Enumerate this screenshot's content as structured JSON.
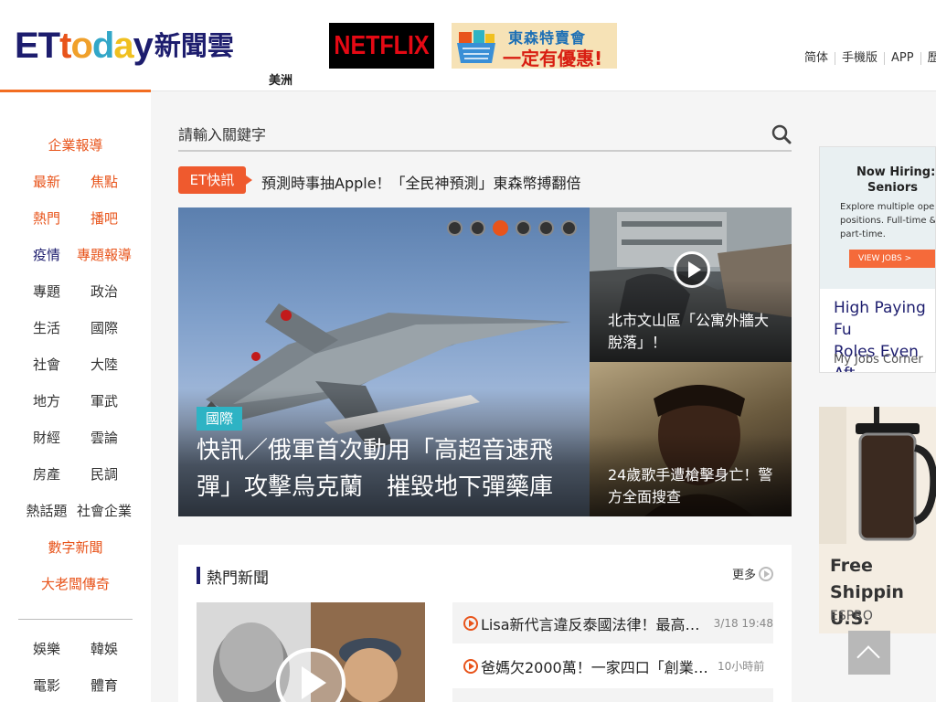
{
  "header": {
    "logo_text": "ETtoday",
    "logo_suffix": "新聞雲",
    "region": "美洲",
    "ad_netflix": "NETFLIX",
    "ad_promo_line1": "東森特賣會",
    "ad_promo_line2": "一定有優惠!",
    "top_links": [
      "简体",
      "手機版",
      "APP",
      "歷"
    ]
  },
  "sidebar": {
    "items": [
      {
        "type": "full",
        "label": "企業報導",
        "color": "orange"
      },
      {
        "type": "pair",
        "left": "最新",
        "right": "焦點",
        "left_color": "orange",
        "right_color": "orange"
      },
      {
        "type": "pair",
        "left": "熱門",
        "right": "播吧",
        "left_color": "orange",
        "right_color": "orange"
      },
      {
        "type": "pair",
        "left": "疫情",
        "right": "專題報導",
        "left_color": "blue",
        "right_color": "orange"
      },
      {
        "type": "pair",
        "left": "專題",
        "right": "政治",
        "left_color": "black",
        "right_color": "black"
      },
      {
        "type": "pair",
        "left": "生活",
        "right": "國際",
        "left_color": "black",
        "right_color": "black"
      },
      {
        "type": "pair",
        "left": "社會",
        "right": "大陸",
        "left_color": "black",
        "right_color": "black"
      },
      {
        "type": "pair",
        "left": "地方",
        "right": "軍武",
        "left_color": "black",
        "right_color": "black"
      },
      {
        "type": "pair",
        "left": "財經",
        "right": "雲論",
        "left_color": "black",
        "right_color": "black"
      },
      {
        "type": "pair",
        "left": "房產",
        "right": "民調",
        "left_color": "black",
        "right_color": "black"
      },
      {
        "type": "pair",
        "left": "熱話題",
        "right": "社會企業",
        "left_color": "black",
        "right_color": "black"
      },
      {
        "type": "full",
        "label": "數字新聞",
        "color": "orange"
      },
      {
        "type": "full",
        "label": "大老闆傳奇",
        "color": "orange"
      },
      {
        "type": "pair",
        "left": "娛樂",
        "right": "韓娛",
        "left_color": "black",
        "right_color": "black"
      },
      {
        "type": "pair",
        "left": "電影",
        "right": "體育",
        "left_color": "black",
        "right_color": "black"
      }
    ]
  },
  "search": {
    "placeholder": "請輸入關鍵字"
  },
  "flash": {
    "tag": "ET快訊",
    "text": "預測時事抽Apple！「全民神預測」東森幣搏翻倍"
  },
  "hero": {
    "category": "國際",
    "title": "快訊／俄軍首次動用「高超音速飛彈」攻擊烏克蘭　摧毀地下彈藥庫",
    "slide_count": 6,
    "active_slide": 3
  },
  "side_tiles": [
    {
      "title": "北市文山區「公寓外牆大脫落」！",
      "has_video": true
    },
    {
      "title": "24歲歌手遭槍擊身亡！警方全面搜查",
      "has_video": false
    }
  ],
  "hot_news": {
    "title": "熱門新聞",
    "more_label": "更多",
    "items": [
      {
        "text": "Lisa新代言違反泰國法律！最高「...",
        "time": "3/18 19:48"
      },
      {
        "text": "爸媽欠2000萬！一家四口「創業賣...",
        "time": "10小時前"
      }
    ]
  },
  "right_ads": [
    {
      "headline1": "Now Hiring:",
      "headline2": "Seniors",
      "body": "Explore multiple open positions. Full-time & part-time.",
      "button": "VIEW JOBS >",
      "title": "High Paying Fu\nRoles Even Aft",
      "source": "My Jobs Corner"
    },
    {
      "title": "Free Shippin\nU.S. Orders $",
      "source": "ESPRO"
    }
  ],
  "colors": {
    "accent": "#e8541b",
    "brand_blue": "#1d1d6e",
    "category_teal": "#2eb3c4"
  }
}
